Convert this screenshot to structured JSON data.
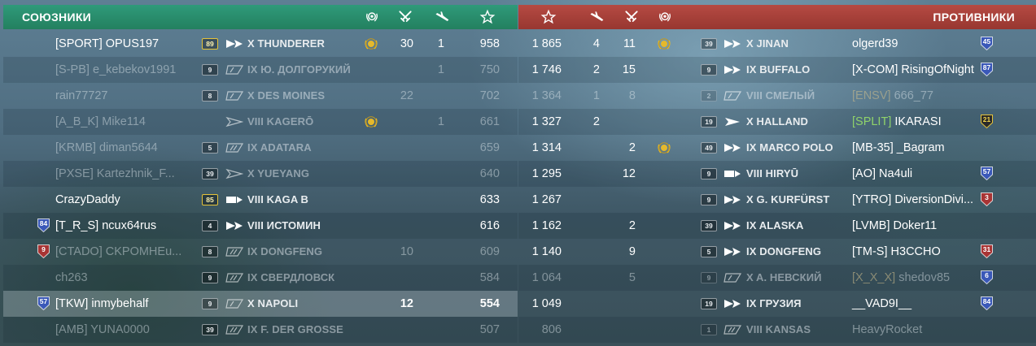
{
  "allies": {
    "title": "СОЮЗНИКИ",
    "header_icons": [
      "laurel-icon",
      "crossed-swords-icon",
      "plane-icon",
      "star-icon"
    ],
    "rows": [
      {
        "clan": "[SPORT]",
        "name": "OPUS197",
        "level": "89",
        "level_gold": true,
        "tier": "X",
        "ship": "THUNDERER",
        "ship_type": "destroyer-elite",
        "achievement": true,
        "kills": "30",
        "planes": "1",
        "score": "958",
        "dim": false
      },
      {
        "clan": "[S-PB]",
        "name": "e_kebekov1991",
        "level": "9",
        "tier": "IX",
        "ship": "Ю. ДОЛГОРУКИЙ",
        "ship_type": "cruiser",
        "planes": "1",
        "score": "750",
        "dim": true
      },
      {
        "clan": "",
        "name": "rain77727",
        "level": "8",
        "tier": "X",
        "ship": "DES MOINES",
        "ship_type": "cruiser",
        "kills": "22",
        "score": "702",
        "dim": true
      },
      {
        "clan": "[A_B_K]",
        "name": "Mike114",
        "level": "",
        "tier": "VIII",
        "ship": "KAGERŌ",
        "ship_type": "destroyer",
        "achievement": true,
        "planes": "1",
        "score": "661",
        "dim": true
      },
      {
        "clan": "[KRMB]",
        "name": "diman5644",
        "level": "5",
        "tier": "IX",
        "ship": "ADATARA",
        "ship_type": "battleship",
        "score": "659",
        "dim": true
      },
      {
        "clan": "[PXSE]",
        "name": "Kartezhnik_F...",
        "level": "39",
        "tier": "X",
        "ship": "YUEYANG",
        "ship_type": "destroyer",
        "score": "640",
        "dim": true
      },
      {
        "clan": "",
        "name": "CrazyDaddy",
        "level": "85",
        "level_gold": true,
        "tier": "VIII",
        "ship": "KAGA B",
        "ship_type": "carrier",
        "score": "633",
        "dim": false
      },
      {
        "clan": "[T_R_S]",
        "name": "ncux64rus",
        "level": "4",
        "tier": "VIII",
        "ship": "ИСТОМИН",
        "ship_type": "destroyer-elite",
        "score": "616",
        "dim": false,
        "badge": "84",
        "badge_color": "#3a58b8"
      },
      {
        "clan": "[CTADO]",
        "name": "CKPOMHEu...",
        "level": "8",
        "tier": "IX",
        "ship": "DONGFENG",
        "ship_type": "battleship",
        "kills": "10",
        "score": "609",
        "dim": true,
        "badge": "9",
        "badge_color": "#a83434"
      },
      {
        "clan": "",
        "name": "ch263",
        "level": "9",
        "tier": "IX",
        "ship": "СВЕРДЛОВСК",
        "ship_type": "battleship",
        "score": "584",
        "dim": true
      },
      {
        "clan": "[TKW]",
        "name": "inmybehalf",
        "level": "9",
        "tier": "X",
        "ship": "NAPOLI",
        "ship_type": "cruiser",
        "kills": "12",
        "score": "554",
        "dim": false,
        "selected": true,
        "badge": "57",
        "badge_color": "#3a58b8"
      },
      {
        "clan": "[AMB]",
        "name": "YUNA0000",
        "level": "39",
        "tier": "IX",
        "ship": "F. DER GROSSE",
        "ship_type": "battleship",
        "score": "507",
        "dim": true
      }
    ]
  },
  "enemies": {
    "title": "ПРОТИВНИКИ",
    "header_icons": [
      "star-icon",
      "plane-icon",
      "crossed-swords-icon",
      "laurel-icon"
    ],
    "rows": [
      {
        "score": "1 865",
        "planes": "4",
        "kills": "11",
        "achievement": true,
        "level": "39",
        "tier": "X",
        "ship": "JINAN",
        "ship_type": "destroyer-elite",
        "clan": "",
        "name": "olgerd39",
        "badge": "45",
        "badge_color": "#3a58b8",
        "dim": false
      },
      {
        "score": "1 746",
        "planes": "2",
        "kills": "15",
        "level": "9",
        "tier": "IX",
        "ship": "BUFFALO",
        "ship_type": "destroyer-elite",
        "clan": "[X-COM]",
        "name": "RisingOfNight",
        "badge": "87",
        "badge_color": "#3a58b8",
        "dim": false
      },
      {
        "score": "1 364",
        "planes": "1",
        "kills": "8",
        "level": "2",
        "tier": "VIII",
        "ship": "СМЕЛЫЙ",
        "ship_type": "cruiser",
        "clan": "[ENSV]",
        "name": "666_77",
        "dim": true,
        "dead": true
      },
      {
        "score": "1 327",
        "planes": "2",
        "level": "19",
        "tier": "X",
        "ship": "HALLAND",
        "ship_type": "destroyer-solid",
        "clan": "[SPLIT]",
        "clan_green": true,
        "name": "IKARASI",
        "badge": "21",
        "badge_color": "#2a2a2a",
        "badge_gold": true,
        "dim": false
      },
      {
        "score": "1 314",
        "kills": "2",
        "achievement": true,
        "level": "49",
        "tier": "IX",
        "ship": "MARCO POLO",
        "ship_type": "destroyer-elite",
        "clan": "[MB-35]",
        "name": "_Bagram",
        "dim": false
      },
      {
        "score": "1 295",
        "kills": "12",
        "level": "9",
        "tier": "VIII",
        "ship": "HIRYŪ",
        "ship_type": "carrier",
        "clan": "[AO]",
        "name": "Na4uli",
        "badge": "57",
        "badge_color": "#3a58b8",
        "dim": false
      },
      {
        "score": "1 267",
        "level": "9",
        "tier": "X",
        "ship": "G. KURFÜRST",
        "ship_type": "destroyer-elite",
        "clan": "[YTRO]",
        "name": "DiversionDivi...",
        "badge": "3",
        "badge_color": "#a83434",
        "dim": false
      },
      {
        "score": "1 162",
        "kills": "2",
        "level": "39",
        "tier": "IX",
        "ship": "ALASKA",
        "ship_type": "destroyer-elite",
        "clan": "[LVMB]",
        "name": "Doker11",
        "dim": false
      },
      {
        "score": "1 140",
        "kills": "9",
        "level": "5",
        "tier": "IX",
        "ship": "DONGFENG",
        "ship_type": "destroyer-elite",
        "clan": "[TM-S]",
        "name": "H3CCHO",
        "badge": "31",
        "badge_color": "#a83434",
        "dim": false
      },
      {
        "score": "1 064",
        "kills": "5",
        "level": "9",
        "tier": "X",
        "ship": "A. НЕВСКИЙ",
        "ship_type": "cruiser",
        "clan": "[X_X_X]",
        "name": "shedov85",
        "badge": "6",
        "badge_color": "#3a58b8",
        "dim": true,
        "dead": true
      },
      {
        "score": "1 049",
        "level": "19",
        "tier": "IX",
        "ship": "ГРУЗИЯ",
        "ship_type": "destroyer-elite",
        "clan": "",
        "name": "__VAD9I__",
        "badge": "84",
        "badge_color": "#3a58b8",
        "dim": false
      },
      {
        "score": "806",
        "level": "1",
        "tier": "VIII",
        "ship": "KANSAS",
        "ship_type": "battleship",
        "clan": "",
        "name": "HeavyRocket",
        "dim": true,
        "dead": true
      }
    ]
  },
  "colors": {
    "allies_header": "#23805f",
    "enemies_header": "#983730",
    "achievement_gold": "#e5b92c"
  }
}
